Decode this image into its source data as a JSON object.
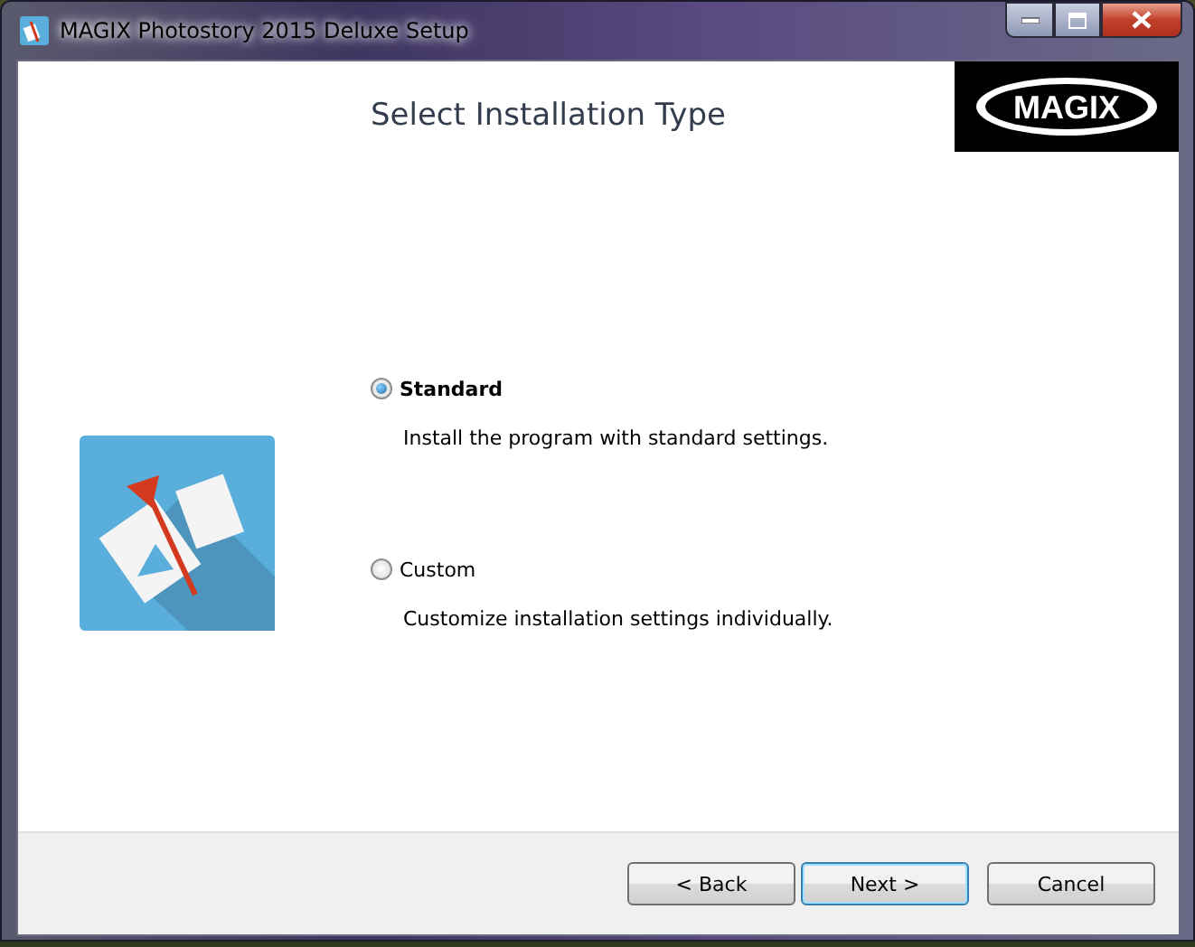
{
  "window": {
    "title": "MAGIX Photostory 2015 Deluxe Setup"
  },
  "header": {
    "title": "Select Installation Type",
    "logo": "MAGIX"
  },
  "options": [
    {
      "kind": "radio",
      "label": "Standard",
      "selected": true,
      "description": "Install the program with standard settings."
    },
    {
      "kind": "radio",
      "label": "Custom",
      "selected": false,
      "description": "Customize installation settings individually."
    }
  ],
  "buttons": [
    {
      "label": "< Back",
      "default": false
    },
    {
      "label": "Next >",
      "default": true
    },
    {
      "label": "Cancel",
      "default": false
    }
  ]
}
